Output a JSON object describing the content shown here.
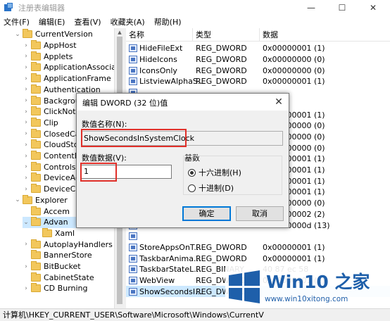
{
  "window": {
    "title": "注册表编辑器",
    "controls": {
      "minimize": "—",
      "maximize": "☐",
      "close": "✕"
    }
  },
  "menu": [
    "文件(F)",
    "编辑(E)",
    "查看(V)",
    "收藏夹(A)",
    "帮助(H)"
  ],
  "tree": [
    {
      "label": "CurrentVersion",
      "arrow": "⌄",
      "expanded": true
    },
    {
      "label": "AppHost",
      "arrow": "›"
    },
    {
      "label": "Applets",
      "arrow": "›"
    },
    {
      "label": "ApplicationAssociatio",
      "arrow": "›"
    },
    {
      "label": "ApplicationFrame",
      "arrow": "›"
    },
    {
      "label": "Authentication",
      "arrow": "›"
    },
    {
      "label": "Backgrou",
      "arrow": "›"
    },
    {
      "label": "ClickNote",
      "arrow": "›"
    },
    {
      "label": "Clip",
      "arrow": "›"
    },
    {
      "label": "ClosedCa",
      "arrow": "›"
    },
    {
      "label": "CloudSto",
      "arrow": "›"
    },
    {
      "label": "ContentD",
      "arrow": "›"
    },
    {
      "label": "Controls",
      "arrow": "›"
    },
    {
      "label": "DeviceAc",
      "arrow": "›"
    },
    {
      "label": "DeviceCa",
      "arrow": "›"
    },
    {
      "label": "Explorer",
      "arrow": "⌄",
      "expanded": true
    },
    {
      "label": "Accem",
      "arrow": ""
    },
    {
      "label": "Advan",
      "arrow": "⌄",
      "selected": true
    },
    {
      "label": "Xaml",
      "arrow": ""
    },
    {
      "label": "AutoplayHandlers",
      "arrow": "›"
    },
    {
      "label": "BannerStore",
      "arrow": ""
    },
    {
      "label": "BitBucket",
      "arrow": "›"
    },
    {
      "label": "CabinetState",
      "arrow": ""
    },
    {
      "label": "CD Burning",
      "arrow": "›"
    }
  ],
  "list": {
    "headers": {
      "name": "名称",
      "type": "类型",
      "data": "数据"
    },
    "rows": [
      {
        "name": "HideFileExt",
        "type": "REG_DWORD",
        "data": "0x00000001 (1)"
      },
      {
        "name": "HideIcons",
        "type": "REG_DWORD",
        "data": "0x00000000 (0)"
      },
      {
        "name": "IconsOnly",
        "type": "REG_DWORD",
        "data": "0x00000000 (0)"
      },
      {
        "name": "ListviewAlphaS...",
        "type": "REG_DWORD",
        "data": "0x00000001 (1)"
      },
      {
        "name": "",
        "type": "",
        "data": ""
      },
      {
        "name": "",
        "type": "",
        "data": ""
      },
      {
        "name": "",
        "type": "",
        "data": "0x00000001 (1)"
      },
      {
        "name": "",
        "type": "",
        "data": "0x00000000 (0)"
      },
      {
        "name": "",
        "type": "",
        "data": "0x00000000 (0)"
      },
      {
        "name": "",
        "type": "",
        "data": "0x00000000 (0)"
      },
      {
        "name": "",
        "type": "",
        "data": "0x00000001 (1)"
      },
      {
        "name": "",
        "type": "",
        "data": "0x00000001 (1)"
      },
      {
        "name": "",
        "type": "",
        "data": "0x00000001 (1)"
      },
      {
        "name": "",
        "type": "",
        "data": "0x00000001 (1)"
      },
      {
        "name": "",
        "type": "",
        "data": "0x00000000 (0)"
      },
      {
        "name": "",
        "type": "",
        "data": "0x00000002 (2)"
      },
      {
        "name": "",
        "type": "",
        "data": "0x0000000d (13)"
      },
      {
        "name": "",
        "type": "",
        "data": ""
      },
      {
        "name": "StoreAppsOnT...",
        "type": "REG_DWORD",
        "data": "0x00000001 (1)"
      },
      {
        "name": "TaskbarAnima...",
        "type": "REG_DWORD",
        "data": "0x00000001 (1)"
      },
      {
        "name": "TaskbarStateL...",
        "type": "REG_BINARY",
        "data": "40 87 ec 58"
      },
      {
        "name": "WebView",
        "type": "REG_DWORD",
        "data": "0x00000001 (1)"
      },
      {
        "name": "ShowSecondsI...",
        "type": "REG_DWORD",
        "data": "",
        "selected": true
      }
    ]
  },
  "statusbar": "计算机\\HKEY_CURRENT_USER\\Software\\Microsoft\\Windows\\CurrentV",
  "dialog": {
    "title": "编辑 DWORD (32 位)值",
    "close": "✕",
    "name_label": "数值名称(N):",
    "name_value": "ShowSecondsInSystemClock",
    "data_label": "数值数据(V):",
    "data_value": "1",
    "base_label": "基数",
    "hex_option": "十六进制(H)",
    "dec_option": "十进制(D)",
    "ok": "确定",
    "cancel": "取消",
    "highlight_color": "#e0302a"
  },
  "watermark": {
    "title": "Win10 之家",
    "url": "www.win10xitong.com",
    "colors": {
      "brand": "#1e5faa"
    }
  }
}
